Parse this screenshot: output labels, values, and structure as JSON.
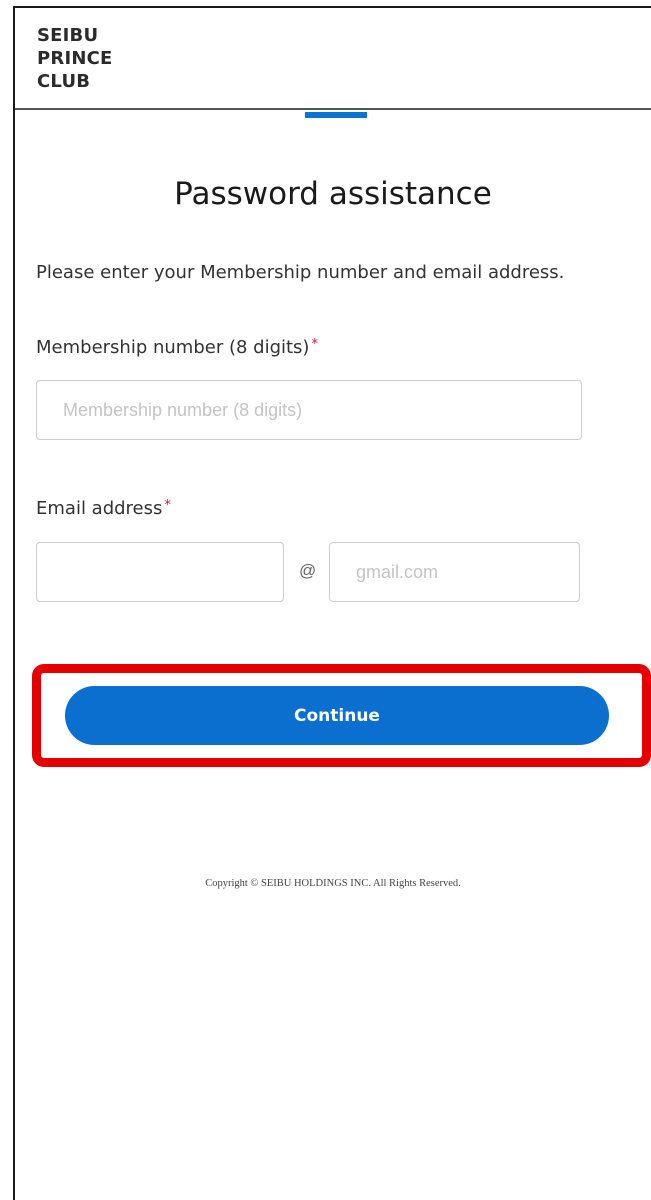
{
  "header": {
    "logo_lines": [
      "SEIBU",
      "PRINCE",
      "CLUB"
    ]
  },
  "page": {
    "title": "Password assistance",
    "instruction": "Please enter your Membership number and email address."
  },
  "form": {
    "membership": {
      "label": "Membership number (8 digits)",
      "required_mark": "*",
      "placeholder": "Membership number (8 digits)",
      "value": ""
    },
    "email": {
      "label": "Email address",
      "required_mark": "*",
      "local_value": "",
      "at_symbol": "@",
      "domain_placeholder": "gmail.com",
      "domain_value": ""
    },
    "continue_label": "Continue"
  },
  "footer": {
    "copyright": "Copyright © SEIBU HOLDINGS INC. All Rights Reserved."
  },
  "colors": {
    "accent": "#0b6fd0",
    "required": "#d0143c",
    "highlight": "#e50000"
  }
}
